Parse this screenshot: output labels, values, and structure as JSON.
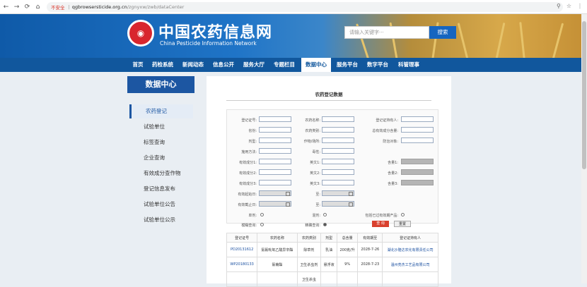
{
  "browser": {
    "insecure": "不安全",
    "host": "qgbrowsersticide.org.cn",
    "path": "/zgnyxw/zwb/dataCenter"
  },
  "header": {
    "title": "中国农药信息网",
    "subtitle": "China Pesticide Information Network",
    "search_placeholder": "请输入关键字···",
    "search_btn": "搜索"
  },
  "nav": [
    "首页",
    "药检系统",
    "新闻动态",
    "信息公开",
    "服务大厅",
    "专题栏目",
    "数据中心",
    "服务平台",
    "数字平台",
    "科管理事"
  ],
  "sidebar": {
    "title": "数据中心",
    "items": [
      "农药登记",
      "试验单位",
      "标签查询",
      "企业查询",
      "有效成分查作物",
      "登记信息发布",
      "试验单位公告",
      "试验单位公示"
    ]
  },
  "main": {
    "title": "农药登记数据",
    "form": {
      "reg_no": "登记证号:",
      "name": "农药名称:",
      "holder": "登记证持有人:",
      "province": "省份:",
      "category": "农药类别:",
      "total": "总有效成分含量:",
      "form_type": "剂型:",
      "crop": "作物/场所:",
      "target": "防治对象:",
      "method": "施用方法:",
      "toxicity": "毒性:",
      "ing1": "有效成分1:",
      "en1": "英文1:",
      "c1": "含量1:",
      "ing2": "有效成分2:",
      "en2": "英文2:",
      "c2": "含量2:",
      "ing3": "有效成分3:",
      "en3": "英文3:",
      "c3": "含量3:",
      "start": "有效起始日:",
      "to": "至:",
      "end": "有效截止日:",
      "to2": "至:",
      "single": "单剂:",
      "mix": "混剂:",
      "include_expired": "包括已过有效期产品:",
      "fuzzy": "模糊查询:",
      "exact": "精确查询:",
      "query": "查 询",
      "reset": "重置"
    },
    "table": {
      "headers": [
        "登记证号",
        "农药名称",
        "农药类别",
        "剂型",
        "总含量",
        "有效期至",
        "登记证持有人"
      ],
      "rows": [
        [
          "PD20131612",
          "氨氟吡氧乙酸异辛酯",
          "除草剂",
          "乳油",
          "200克/升",
          "2028-7-26",
          "湖北沙隆达农化有限责任公司"
        ],
        [
          "WP20180133",
          "氯菊酯",
          "卫生杀虫剂",
          "悬浮液",
          "9%",
          "2028-7-23",
          "温州亮杰工艺品有限公司"
        ],
        [
          "",
          "",
          "卫生杀虫",
          "",
          "",
          "",
          ""
        ]
      ]
    }
  }
}
